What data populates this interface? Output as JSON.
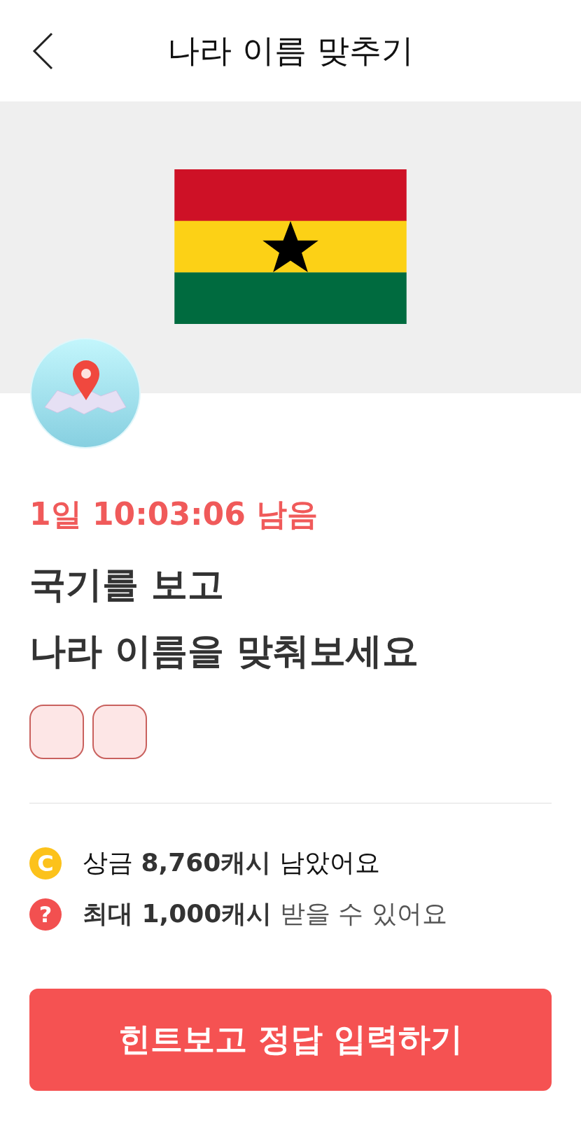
{
  "header": {
    "title": "나라 이름 맞추기"
  },
  "flag": {
    "kind": "tricolor_star"
  },
  "timer": "1일 10:03:06 남음",
  "question": [
    "국기를 보고",
    "나라 이름을 맞춰보세요"
  ],
  "answer_boxes": [
    {
      "kind": "empty"
    },
    {
      "kind": "empty"
    }
  ],
  "info": [
    {
      "kind": "coin",
      "glyph": "C",
      "text": "상금 **8,760캐시** 남았어요"
    },
    {
      "kind": "question",
      "glyph": "?",
      "text": "**최대 1,000캐시** 받을 수 있어요"
    }
  ],
  "button": "힌트보고 정답 입력하기"
}
